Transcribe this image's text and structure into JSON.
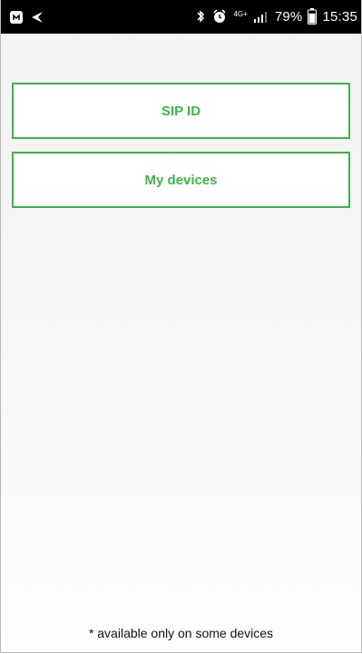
{
  "status_bar": {
    "icons_left": [
      "notification-icon",
      "navigation-icon"
    ],
    "icons_right": [
      "bluetooth-icon",
      "alarm-icon",
      "network-type-icon",
      "signal-icon",
      "battery-icon"
    ],
    "network_type": "4G+",
    "battery_percent": "79%",
    "time": "15:35",
    "battery_level": 0.79
  },
  "main": {
    "sip_button_label": "SIP ID",
    "devices_button_label": "My devices",
    "footnote": "* available only on some devices"
  },
  "colors": {
    "accent": "#3bb54a",
    "status_bar_bg": "#000000",
    "status_text": "#ffffff",
    "background": "#f5f5f5"
  }
}
